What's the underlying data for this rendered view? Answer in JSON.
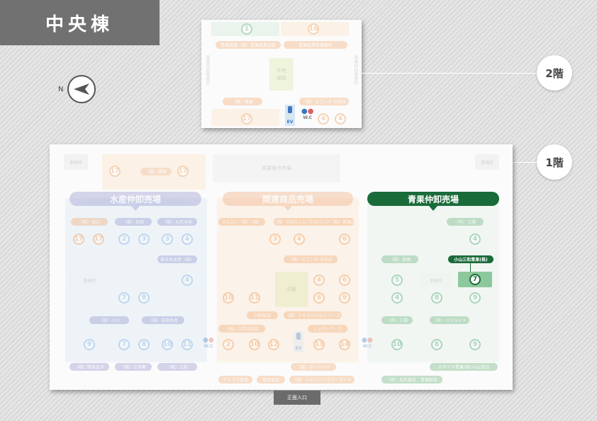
{
  "header": {
    "title": "中央棟"
  },
  "compass": {
    "north_label": "N"
  },
  "floors": {
    "f2": "2階",
    "f1": "1階"
  },
  "entrance": "正面入口",
  "colors": {
    "fish": "#8c8cc8",
    "related": "#f0a878",
    "veg": "#1a6b3a",
    "green_light": "#88c49a",
    "orange": "#f2b070",
    "blue": "#6aa0d8"
  },
  "floor2": {
    "nums_top": [
      "1",
      "16"
    ],
    "pills_top": [
      "青果商事（株）青果商業会館",
      "青果卸業者事務所"
    ],
    "side_left": "青果仲卸事務所",
    "side_right": "青果仲卸事務所",
    "center": "中央\n通路",
    "pill_bottom_left": "（株）東果",
    "pill_bottom_right": "（株）セブンネ 中央店",
    "num_bottom_left": "17",
    "nums_bottom_right": [
      "4",
      "4"
    ],
    "ev": "EV",
    "wc": "W.C"
  },
  "floor1": {
    "top_left_box": "事務所",
    "top_right_box": "事務所",
    "top_center": "青果保冷市場",
    "top_pill": "（株）関西",
    "top_nums": [
      "17",
      "17"
    ],
    "sections": {
      "fish": "水産仲卸売場",
      "related": "関連商品売場",
      "veg": "青果仲卸売場"
    },
    "fish": {
      "pills_row1": [
        "（株）田辺",
        "（株）和田",
        "（株）丸京水産"
      ],
      "nums_row1": [
        "17",
        "17",
        "2",
        "3",
        "3",
        "4"
      ],
      "pill_mid": "東日本水産（株）",
      "num_mid": "4",
      "office": "事務所",
      "nums_row2": [
        "7",
        "8"
      ],
      "pills_row2": [
        "（株）小川",
        "（株）前田水産"
      ],
      "nums_row3": [
        "9",
        "7",
        "8",
        "10",
        "11"
      ],
      "pills_row3": [
        "（株）岡本北洋",
        "（株）三河屋",
        "（株）三和"
      ]
    },
    "related": {
      "pills_row1": [
        "マルコン（株）（株）",
        "（株）すばらしい プロパック（株）青果店"
      ],
      "nums_row1": [
        "3",
        "4",
        "6"
      ],
      "pill_mid": "（株）セブンネ 中央店",
      "center": "中庭",
      "nums_row2": [
        "10",
        "11",
        "4",
        "6",
        "8",
        "9"
      ],
      "pills_row2": [
        "小野食品",
        "（株）とちぎけんなんフーズ"
      ],
      "pills_row3": [
        "（株）八百幸商店",
        "ニッサンフーズ"
      ],
      "nums_row3": [
        "2",
        "10",
        "12",
        "13",
        "14"
      ],
      "pills_row4": [
        "（株）ボーシャツ"
      ],
      "pills_row5": [
        "アップス食品",
        "青木食品",
        "（株）ジャパンフラワーライト"
      ]
    },
    "veg": {
      "pill_top": "（有）三陽",
      "num_top": "4",
      "pill_left": "（株）宮崎",
      "pill_highlight": "小山三和青果(株)",
      "office": "事務所",
      "nums_row2": [
        "5",
        "7"
      ],
      "nums_row3": [
        "4",
        "8",
        "9"
      ],
      "pills_row3": [
        "（有）三陽",
        "（有）ベジメイト"
      ],
      "nums_row4": [
        "10",
        "8",
        "9"
      ],
      "pill_right": "カネイチ青果(株) 小山支社",
      "pill_bottom": "（有）丸久商店　青果卸店"
    },
    "ev": "EV",
    "wc": "W.C"
  }
}
